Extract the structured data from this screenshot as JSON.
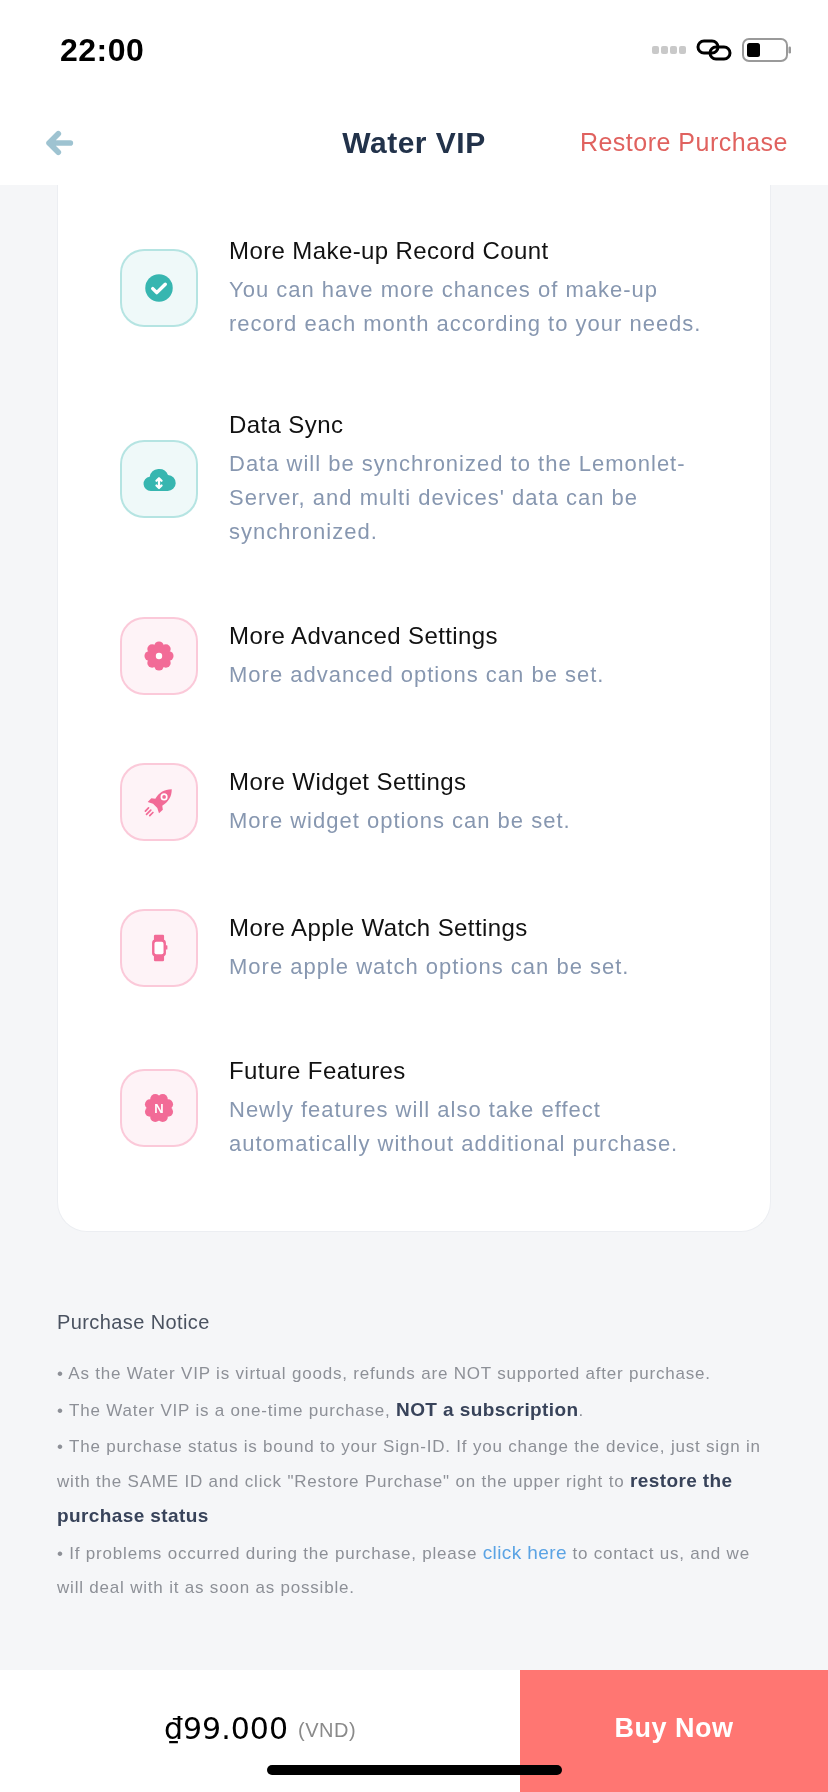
{
  "status_bar": {
    "time": "22:00"
  },
  "header": {
    "title": "Water VIP",
    "restore_button": "Restore Purchase"
  },
  "features": [
    {
      "title": "More Make-up Record Count",
      "description": "You can have more chances of make-up record each month according to your needs.",
      "color": "#37b6b0"
    },
    {
      "title": "Data Sync",
      "description": "Data will be synchronized to the Lemonlet-Server, and multi devices' data can be synchronized.",
      "color": "#37b6b0"
    },
    {
      "title": "More Advanced Settings",
      "description": "More advanced options can be set.",
      "color": "#f26b97"
    },
    {
      "title": "More Widget Settings",
      "description": "More widget options can be set.",
      "color": "#f26b97"
    },
    {
      "title": "More Apple Watch Settings",
      "description": "More apple watch options can be set.",
      "color": "#f26b97"
    },
    {
      "title": "Future Features",
      "description": "Newly features will also take effect automatically without additional purchase.",
      "color": "#f26b97",
      "badge_letter": "N"
    }
  ],
  "purchase_notice": {
    "title": "Purchase Notice",
    "items": [
      {
        "text": "• As the Water VIP is virtual goods, refunds are NOT supported after purchase."
      },
      {
        "text": "• The Water VIP is a one-time purchase, **NOT a subscription**."
      },
      {
        "text": "• The purchase status is bound to your Sign-ID. If you change the device, just sign in with the SAME ID and click \"Restore Purchase\" on the upper right to **restore the purchase status**"
      },
      {
        "text": "• If problems occurred during the purchase, please ",
        "link": "click here",
        "text_after": " to contact us, and we will deal with it as soon as possible."
      }
    ]
  },
  "footer": {
    "price": "₫99.000",
    "currency": "(VND)",
    "buy_button": "Buy Now"
  }
}
